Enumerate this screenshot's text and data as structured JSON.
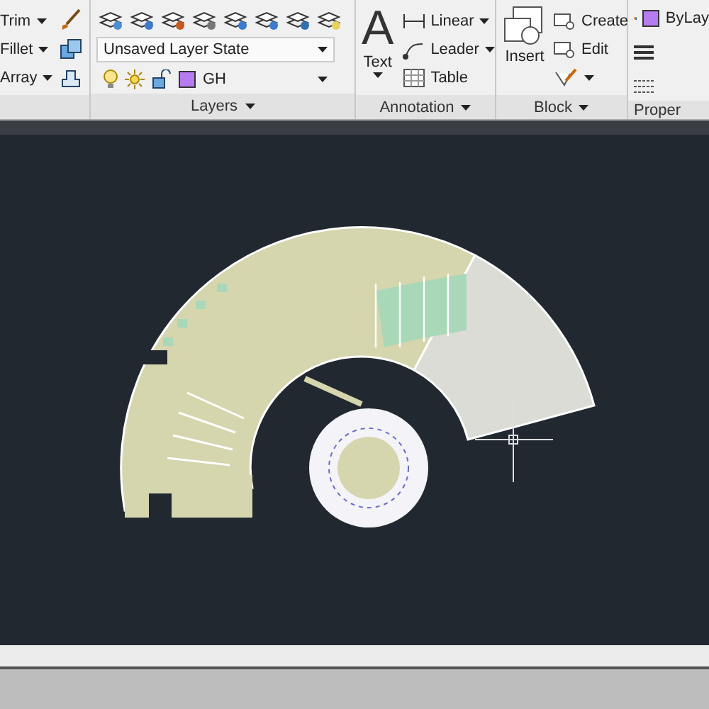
{
  "modify": {
    "items": [
      {
        "label": "Trim",
        "has_menu": true
      },
      {
        "label": "Fillet",
        "has_menu": true
      },
      {
        "label": "Array",
        "has_menu": true
      }
    ]
  },
  "layers": {
    "title": "Layers",
    "layer_state": "Unsaved Layer State",
    "current_layer": "GH"
  },
  "annotation": {
    "title": "Annotation",
    "big_icon": "A",
    "big_tool": "Text",
    "items": [
      {
        "label": "Linear",
        "has_menu": true
      },
      {
        "label": "Leader",
        "has_menu": true
      },
      {
        "label": "Table",
        "has_menu": false
      }
    ]
  },
  "block": {
    "title": "Block",
    "big_tool": "Insert",
    "items": [
      {
        "label": "Create"
      },
      {
        "label": "Edit"
      }
    ]
  },
  "properties": {
    "title": "Proper",
    "color_setting": "ByLay"
  }
}
